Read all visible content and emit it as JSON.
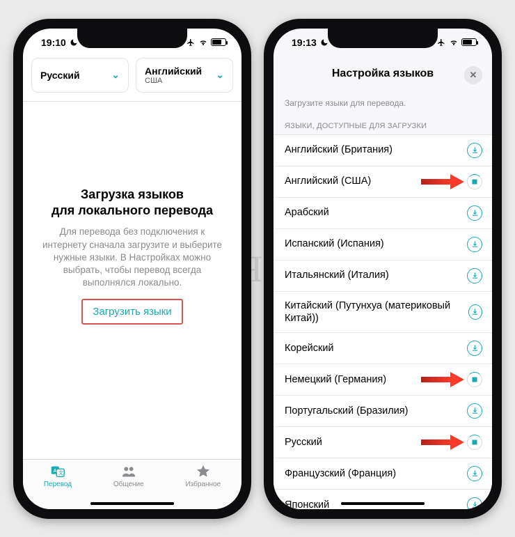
{
  "phone1": {
    "status": {
      "time": "19:10"
    },
    "lang_left": {
      "label": "Русский"
    },
    "lang_right": {
      "label": "Английский",
      "sub": "США"
    },
    "empty": {
      "title_l1": "Загрузка языков",
      "title_l2": "для локального перевода",
      "desc": "Для перевода без подключения к интернету сначала загрузите и выберите нужные языки. В Настройках можно выбрать, чтобы перевод всегда выполнялся локально.",
      "button": "Загрузить языки"
    },
    "tabs": {
      "translate": "Перевод",
      "chat": "Общение",
      "fav": "Избранное"
    }
  },
  "phone2": {
    "status": {
      "time": "19:13"
    },
    "title": "Настройка языков",
    "hint": "Загрузите языки для перевода.",
    "section": "ЯЗЫКИ, ДОСТУПНЫЕ ДЛЯ ЗАГРУЗКИ",
    "languages": [
      {
        "label": "Английский (Британия)",
        "state": "download",
        "arrow": false
      },
      {
        "label": "Английский (США)",
        "state": "progress",
        "arrow": true
      },
      {
        "label": "Арабский",
        "state": "download",
        "arrow": false
      },
      {
        "label": "Испанский (Испания)",
        "state": "download",
        "arrow": false
      },
      {
        "label": "Итальянский (Италия)",
        "state": "download",
        "arrow": false
      },
      {
        "label": "Китайский (Путунхуа (материковый Китай))",
        "state": "download",
        "arrow": false
      },
      {
        "label": "Корейский",
        "state": "download",
        "arrow": false
      },
      {
        "label": "Немецкий (Германия)",
        "state": "progress",
        "arrow": true
      },
      {
        "label": "Португальский (Бразилия)",
        "state": "download",
        "arrow": false
      },
      {
        "label": "Русский",
        "state": "progress",
        "arrow": true
      },
      {
        "label": "Французский (Франция)",
        "state": "download",
        "arrow": false
      },
      {
        "label": "Японский",
        "state": "download",
        "arrow": false
      }
    ]
  },
  "colors": {
    "accent": "#18aab0",
    "callout": "#d9534f"
  },
  "watermark": "Яблык"
}
